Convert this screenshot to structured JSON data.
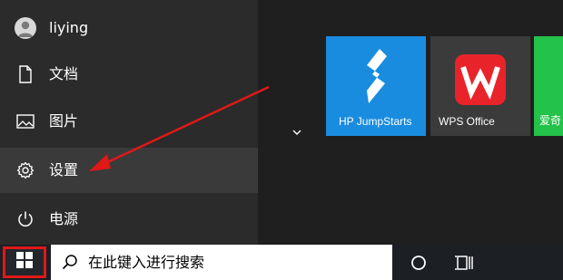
{
  "start_menu": {
    "user": {
      "name": "liying",
      "icon": "user-avatar-icon"
    },
    "items": [
      {
        "label": "文档",
        "icon": "document-icon"
      },
      {
        "label": "图片",
        "icon": "picture-icon"
      },
      {
        "label": "设置",
        "icon": "gear-icon",
        "selected": true
      },
      {
        "label": "电源",
        "icon": "power-icon"
      }
    ]
  },
  "tiles": [
    {
      "label": "HP JumpStarts",
      "color": "#1a8ce0"
    },
    {
      "label": "WPS Office",
      "color": "#3b3b3b"
    },
    {
      "label": "爱奇",
      "color": "#23c24a"
    }
  ],
  "taskbar": {
    "search_placeholder": "在此键入进行搜索",
    "start_highlight_color": "#e01818"
  },
  "annotation": {
    "color": "#e01818"
  }
}
